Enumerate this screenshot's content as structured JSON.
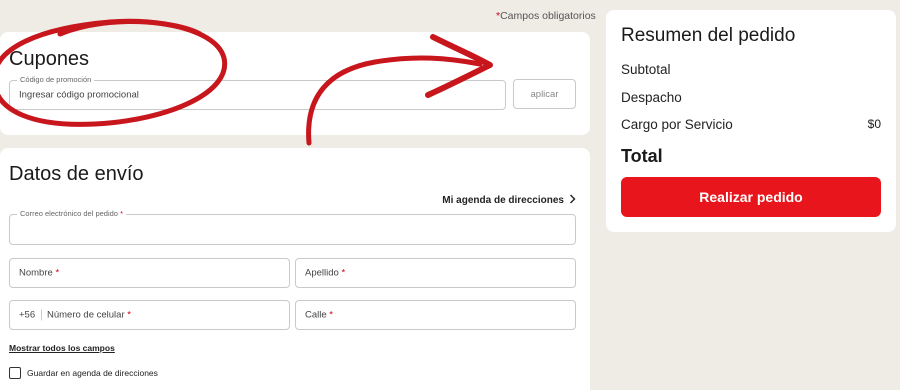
{
  "required_note": {
    "star": "*",
    "text": "Campos obligatorios"
  },
  "coupons": {
    "title": "Cupones",
    "promo_legend": "Código de promoción",
    "promo_placeholder": "Ingresar código promocional",
    "apply_label": "aplicar"
  },
  "shipping": {
    "title": "Datos de envío",
    "agenda_link": "Mi agenda de direcciones",
    "email_legend": "Correo electrónico del pedido",
    "name_label": "Nombre",
    "lastname_label": "Apellido",
    "phone_prefix": "+56",
    "phone_label": "Número de celular",
    "street_label": "Calle",
    "required_star": "*",
    "show_all_link": "Mostrar todos los campos",
    "save_label": "Guardar en agenda de direcciones"
  },
  "summary": {
    "title": "Resumen del pedido",
    "subtotal_label": "Subtotal",
    "despacho_label": "Despacho",
    "service_label": "Cargo por Servicio",
    "service_value": "$0",
    "total_label": "Total",
    "order_button": "Realizar pedido"
  },
  "colors": {
    "background": "#efebe5",
    "accent_red": "#e8161c",
    "annotation_red": "#c8161d"
  },
  "icons": {
    "agenda_chevron": "chevron-right-icon",
    "annotation_arrow": "curved-arrow-annotation",
    "annotation_circle": "hand-drawn-circle-annotation"
  }
}
